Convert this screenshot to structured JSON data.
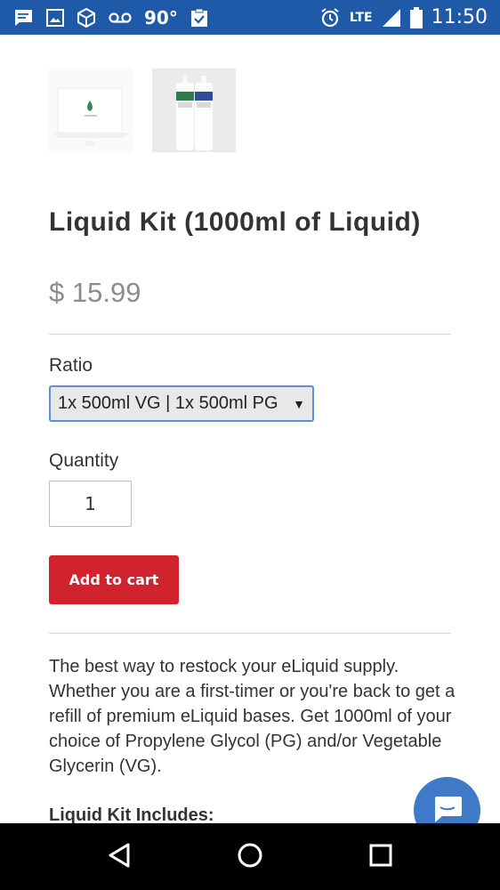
{
  "status_bar": {
    "temperature": "90°",
    "network": "LTE",
    "time": "11:50"
  },
  "product": {
    "title": "Liquid Kit (1000ml of Liquid)",
    "price": "$ 15.99",
    "ratio_label": "Ratio",
    "ratio_selected": "1x 500ml VG | 1x 500ml PG",
    "quantity_label": "Quantity",
    "quantity_value": "1",
    "add_to_cart_label": "Add to cart",
    "description": "The best way to restock your eLiquid supply. Whether you are a first-timer or you're back to get a refill of premium eLiquid bases. Get 1000ml of your choice of Propylene Glycol (PG) and/or Vegetable Glycerin (VG).",
    "includes_heading": "Liquid Kit Includes:"
  },
  "colors": {
    "status_bar": "#1f5aa8",
    "add_to_cart": "#d0232e",
    "chat_button": "#3f7ac9"
  },
  "icons": [
    "message-icon",
    "image-icon",
    "box-icon",
    "voicemail-icon",
    "clipboard-check-icon",
    "alarm-icon",
    "signal-icon",
    "battery-icon",
    "chat-icon",
    "back-icon",
    "home-icon",
    "recents-icon"
  ]
}
